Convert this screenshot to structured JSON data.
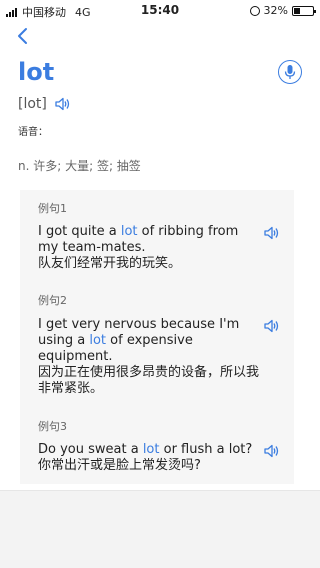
{
  "status_bar": {
    "carrier": "中国移动",
    "network": "4G",
    "time": "15:40",
    "battery": "32%",
    "battery_level": 0.32
  },
  "header": {
    "back_icon": "chevron-left-icon",
    "word": "lot",
    "mic_icon": "microphone-icon"
  },
  "pronunciation": {
    "phonetic": "[lot]",
    "speaker_icon": "speaker-icon",
    "label": "语音："
  },
  "definition": "n. 许多; 大量; 签; 抽签",
  "examples": [
    {
      "label": "例句1",
      "before": "I got quite a ",
      "highlight": "lot",
      "after": " of ribbing from my team-mates.",
      "translation": "队友们经常开我的玩笑。"
    },
    {
      "label": "例句2",
      "before": "I get very nervous because I'm using a ",
      "highlight": "lot",
      "after": " of expensive equipment.",
      "translation": "因为正在使用很多昂贵的设备，所以我非常紧张。"
    },
    {
      "label": "例句3",
      "before": "Do you sweat a ",
      "highlight": "lot",
      "after": " or flush a lot?",
      "translation": "你常出汗或是脸上常发烫吗?"
    }
  ],
  "colors": {
    "accent": "#3b7de0",
    "panel_bg": "#f6f6f6"
  }
}
